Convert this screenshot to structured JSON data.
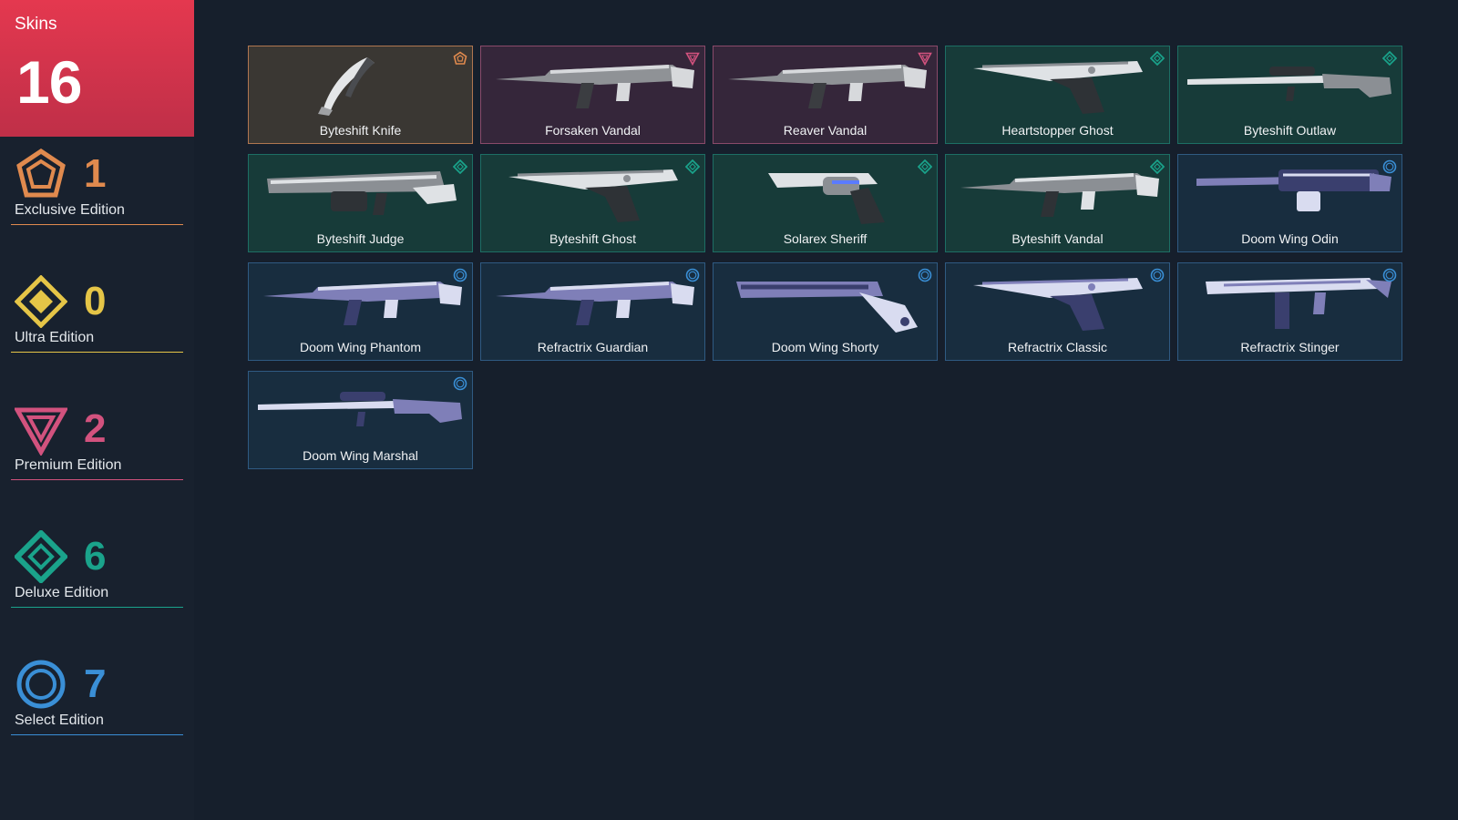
{
  "header": {
    "label": "Skins",
    "count": "16"
  },
  "editions": [
    {
      "key": "exclusive",
      "count": "1",
      "label": "Exclusive Edition",
      "icon": "exclusive-pentagon-icon",
      "color": "#e08a4e"
    },
    {
      "key": "ultra",
      "count": "0",
      "label": "Ultra Edition",
      "icon": "ultra-diamond-icon",
      "color": "#e5c547"
    },
    {
      "key": "premium",
      "count": "2",
      "label": "Premium Edition",
      "icon": "premium-triangle-icon",
      "color": "#d2527e"
    },
    {
      "key": "deluxe",
      "count": "6",
      "label": "Deluxe Edition",
      "icon": "deluxe-diamond-icon",
      "color": "#1aa38b"
    },
    {
      "key": "select",
      "count": "7",
      "label": "Select Edition",
      "icon": "select-circle-icon",
      "color": "#3a8fd6"
    }
  ],
  "tier_styles": {
    "exclusive": {
      "bg": "#3a3733",
      "border": "#b07650"
    },
    "premium": {
      "bg": "#35263a",
      "border": "#8a4a6a"
    },
    "deluxe": {
      "bg": "#173b39",
      "border": "#1d6e64"
    },
    "select": {
      "bg": "#182d3f",
      "border": "#2f5a82"
    }
  },
  "skins": [
    {
      "name": "Byteshift Knife",
      "tier": "exclusive",
      "weapon": "knife"
    },
    {
      "name": "Forsaken Vandal",
      "tier": "premium",
      "weapon": "rifle"
    },
    {
      "name": "Reaver Vandal",
      "tier": "premium",
      "weapon": "rifle"
    },
    {
      "name": "Heartstopper Ghost",
      "tier": "deluxe",
      "weapon": "pistol"
    },
    {
      "name": "Byteshift Outlaw",
      "tier": "deluxe",
      "weapon": "sniper"
    },
    {
      "name": "Byteshift Judge",
      "tier": "deluxe",
      "weapon": "shotgun"
    },
    {
      "name": "Byteshift Ghost",
      "tier": "deluxe",
      "weapon": "pistol"
    },
    {
      "name": "Solarex Sheriff",
      "tier": "deluxe",
      "weapon": "revolver"
    },
    {
      "name": "Byteshift Vandal",
      "tier": "deluxe",
      "weapon": "rifle"
    },
    {
      "name": "Doom Wing Odin",
      "tier": "select",
      "weapon": "lmg"
    },
    {
      "name": "Doom Wing Phantom",
      "tier": "select",
      "weapon": "rifle"
    },
    {
      "name": "Refractrix Guardian",
      "tier": "select",
      "weapon": "rifle"
    },
    {
      "name": "Doom Wing Shorty",
      "tier": "select",
      "weapon": "shorty"
    },
    {
      "name": "Refractrix Classic",
      "tier": "select",
      "weapon": "pistol"
    },
    {
      "name": "Refractrix Stinger",
      "tier": "select",
      "weapon": "smg"
    },
    {
      "name": "Doom Wing Marshal",
      "tier": "select",
      "weapon": "sniper"
    }
  ]
}
